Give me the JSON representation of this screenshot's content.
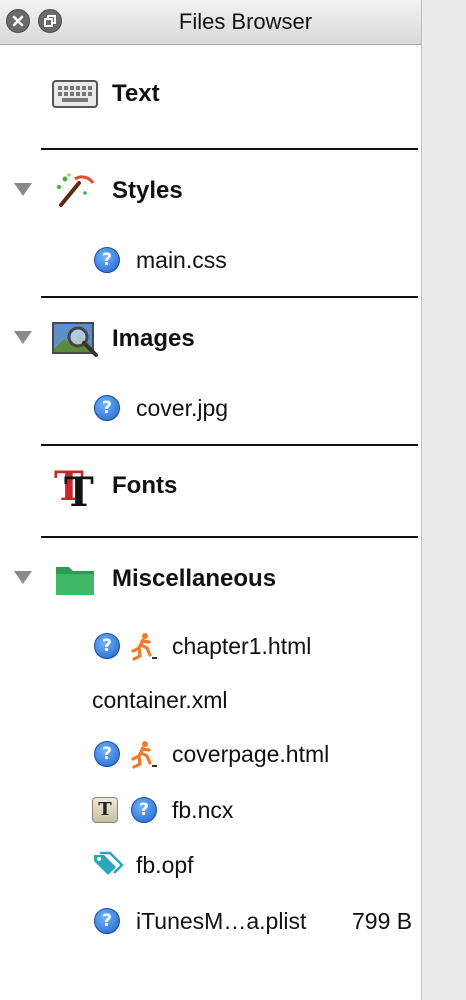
{
  "window": {
    "title": "Files Browser"
  },
  "categories": {
    "text": {
      "label": "Text",
      "icon": "keyboard-icon"
    },
    "styles": {
      "label": "Styles",
      "icon": "magic-wand-icon",
      "files": [
        {
          "name": "main.css",
          "icon": "question-icon"
        }
      ]
    },
    "images": {
      "label": "Images",
      "icon": "image-magnifier-icon",
      "files": [
        {
          "name": "cover.jpg",
          "icon": "question-icon"
        }
      ]
    },
    "fonts": {
      "label": "Fonts",
      "icon": "font-icon"
    },
    "misc": {
      "label": "Miscellaneous",
      "icon": "folder-icon",
      "files": [
        {
          "name": "chapter1.html",
          "icons": [
            "question-icon",
            "runner-icon"
          ]
        },
        {
          "name": "container.xml",
          "icons": []
        },
        {
          "name": "coverpage.html",
          "icons": [
            "question-icon",
            "runner-icon"
          ]
        },
        {
          "name": "fb.ncx",
          "icons": [
            "text-t-icon",
            "question-icon"
          ]
        },
        {
          "name": "fb.opf",
          "icons": [
            "tag-icon"
          ]
        },
        {
          "name": "iTunesM…a.plist",
          "icons": [
            "question-icon"
          ],
          "size": "799 B"
        }
      ]
    }
  },
  "colors": {
    "folder": "#3aa862",
    "runner": "#f07a2a",
    "tag": "#2aa7b8",
    "question": "#2b74d8",
    "separator": "#111111"
  }
}
